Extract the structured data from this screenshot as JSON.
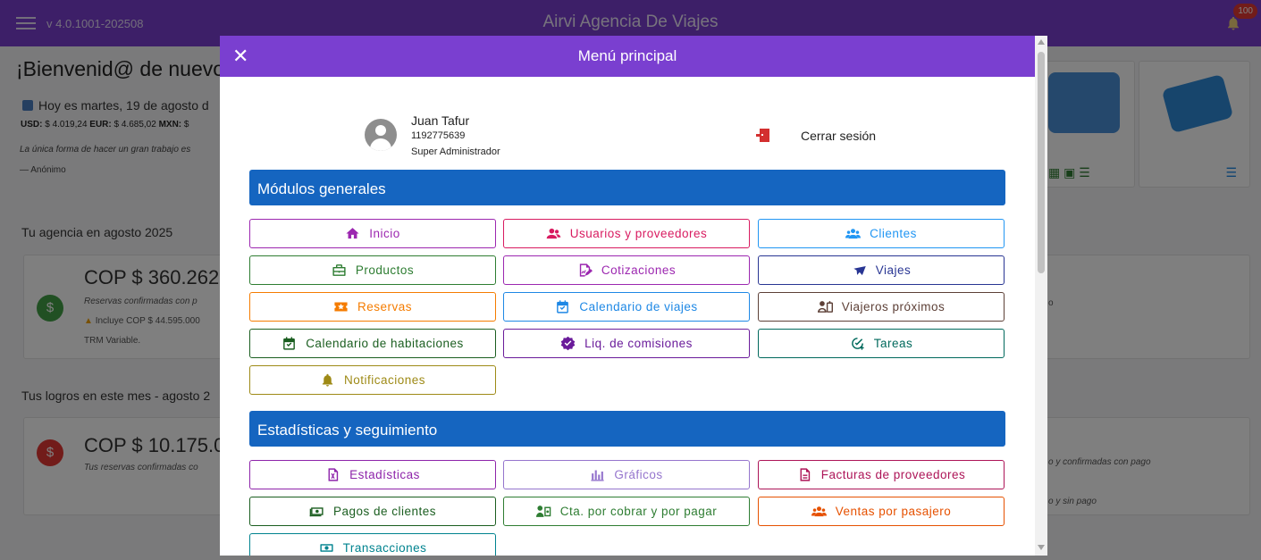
{
  "app": {
    "version": "v 4.0.1001-202508",
    "brand": "Airvi Agencia De Viajes",
    "notifications_count": "100"
  },
  "background": {
    "welcome": "¡Bienvenid@ de nuevo",
    "today": "Hoy es martes, 19 de agosto d",
    "rates": {
      "usd_label": "USD:",
      "usd_value": "$ 4.019,24",
      "eur_label": "EUR:",
      "eur_value": "$ 4.685,02",
      "mxn_label": "MXN:",
      "mxn_value": "$"
    },
    "quote": "La única forma de hacer un gran trabajo es",
    "author": "— Anónimo",
    "agency_title": "Tu agencia en agosto 2025",
    "agency_amount": "COP $ 360.262",
    "agency_desc": "Reservas confirmadas con p",
    "agency_warning": "Incluye COP $ 44.595.000",
    "agency_trm": "TRM Variable.",
    "achievements_title": "Tus logros en este mes - agosto 2",
    "achievements_amount": "COP $ 10.175.0",
    "achievements_desc": "Tus reservas confirmadas co",
    "right_text_1": "o",
    "right_text_2": "o y confirmadas con pago",
    "right_text_3": "o y sin pago"
  },
  "modal": {
    "title": "Menú principal",
    "user": {
      "name": "Juan Tafur",
      "id": "1192775639",
      "role": "Super Administrador"
    },
    "logout_label": "Cerrar sesión",
    "sections": [
      {
        "title": "Módulos generales",
        "items": [
          {
            "label": "Inicio",
            "icon": "home-icon",
            "color": "#9c27b0"
          },
          {
            "label": "Usuarios y proveedores",
            "icon": "users-icon",
            "color": "#d81b60"
          },
          {
            "label": "Clientes",
            "icon": "group-icon",
            "color": "#2196f3"
          },
          {
            "label": "Productos",
            "icon": "briefcase-icon",
            "color": "#2e7d32"
          },
          {
            "label": "Cotizaciones",
            "icon": "quote-doc-icon",
            "color": "#9c27b0"
          },
          {
            "label": "Viajes",
            "icon": "airplane-icon",
            "color": "#283593"
          },
          {
            "label": "Reservas",
            "icon": "star-ticket-icon",
            "color": "#f57c00"
          },
          {
            "label": "Calendario de viajes",
            "icon": "calendar-check-icon",
            "color": "#1e88e5"
          },
          {
            "label": "Viajeros próximos",
            "icon": "traveler-icon",
            "color": "#5d4037"
          },
          {
            "label": "Calendario de habitaciones",
            "icon": "calendar-room-icon",
            "color": "#1b5e20"
          },
          {
            "label": "Liq. de comisiones",
            "icon": "verified-badge-icon",
            "color": "#6a1b9a"
          },
          {
            "label": "Tareas",
            "icon": "task-check-icon",
            "color": "#00695c"
          },
          {
            "label": "Notificaciones",
            "icon": "bell-icon",
            "color": "#9e8a16"
          }
        ]
      },
      {
        "title": "Estadísticas y seguimiento",
        "items": [
          {
            "label": "Estadísticas",
            "icon": "excel-doc-icon",
            "color": "#8e24aa"
          },
          {
            "label": "Gráficos",
            "icon": "bar-chart-icon",
            "color": "#9575cd"
          },
          {
            "label": "Facturas de proveedores",
            "icon": "invoice-icon",
            "color": "#ad1457"
          },
          {
            "label": "Pagos de clientes",
            "icon": "cash-icon",
            "color": "#1b5e20"
          },
          {
            "label": "Cta. por cobrar y por pagar",
            "icon": "accounts-icon",
            "color": "#2e7d32"
          },
          {
            "label": "Ventas por pasajero",
            "icon": "passengers-icon",
            "color": "#e65100"
          },
          {
            "label": "Transacciones",
            "icon": "transactions-icon",
            "color": "#00838f"
          }
        ]
      }
    ]
  }
}
